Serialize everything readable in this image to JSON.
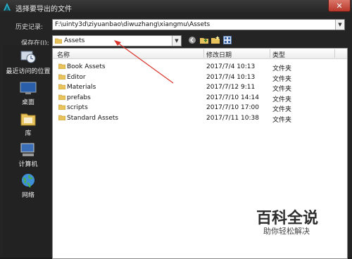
{
  "window": {
    "title": "选择要导出的文件",
    "close_label": "✕"
  },
  "history": {
    "label": "历史记录:",
    "value": "F:\\uinty3d\\ziyuanbao\\diwuzhang\\xiangmu\\Assets"
  },
  "save_in": {
    "label": "保存在(I):",
    "value": "Assets"
  },
  "places": [
    {
      "label": "最近访问的位置",
      "icon": "recent-places-icon"
    },
    {
      "label": "桌面",
      "icon": "desktop-icon"
    },
    {
      "label": "库",
      "icon": "libraries-icon"
    },
    {
      "label": "计算机",
      "icon": "computer-icon"
    },
    {
      "label": "网络",
      "icon": "network-icon"
    }
  ],
  "columns": {
    "name": "名称",
    "date": "修改日期",
    "type": "类型"
  },
  "files": [
    {
      "name": "Book Assets",
      "date": "2017/7/4 10:13",
      "type": "文件夹"
    },
    {
      "name": "Editor",
      "date": "2017/7/4 10:13",
      "type": "文件夹"
    },
    {
      "name": "Materials",
      "date": "2017/7/12 9:11",
      "type": "文件夹"
    },
    {
      "name": "prefabs",
      "date": "2017/7/10 14:14",
      "type": "文件夹"
    },
    {
      "name": "scripts",
      "date": "2017/7/10 17:00",
      "type": "文件夹"
    },
    {
      "name": "Standard Assets",
      "date": "2017/7/11 10:38",
      "type": "文件夹"
    }
  ],
  "watermark": {
    "title": "百科全说",
    "subtitle": "助你轻松解决"
  },
  "colors": {
    "folder": "#e8c25a",
    "annotation_arrow": "#d9342b"
  }
}
